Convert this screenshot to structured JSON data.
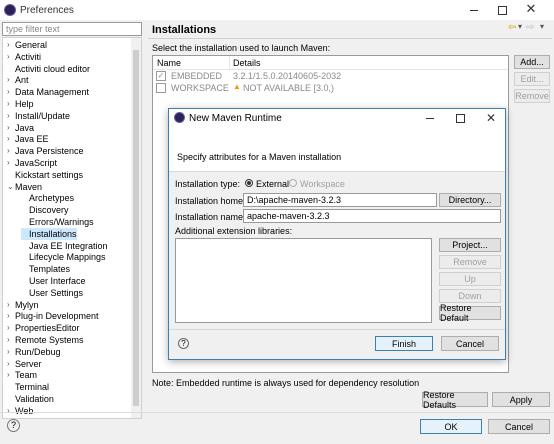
{
  "window": {
    "title": "Preferences"
  },
  "filter": {
    "placeholder": "type filter text"
  },
  "tree": [
    {
      "label": "General",
      "expanded": false,
      "level": 0
    },
    {
      "label": "Activiti",
      "expanded": false,
      "level": 0
    },
    {
      "label": "Activiti cloud editor",
      "expanded": null,
      "level": 0
    },
    {
      "label": "Ant",
      "expanded": false,
      "level": 0
    },
    {
      "label": "Data Management",
      "expanded": false,
      "level": 0
    },
    {
      "label": "Help",
      "expanded": false,
      "level": 0
    },
    {
      "label": "Install/Update",
      "expanded": false,
      "level": 0
    },
    {
      "label": "Java",
      "expanded": false,
      "level": 0
    },
    {
      "label": "Java EE",
      "expanded": false,
      "level": 0
    },
    {
      "label": "Java Persistence",
      "expanded": false,
      "level": 0
    },
    {
      "label": "JavaScript",
      "expanded": false,
      "level": 0
    },
    {
      "label": "Kickstart settings",
      "expanded": null,
      "level": 0
    },
    {
      "label": "Maven",
      "expanded": true,
      "level": 0
    },
    {
      "label": "Archetypes",
      "expanded": null,
      "level": 1
    },
    {
      "label": "Discovery",
      "expanded": null,
      "level": 1
    },
    {
      "label": "Errors/Warnings",
      "expanded": null,
      "level": 1
    },
    {
      "label": "Installations",
      "expanded": null,
      "level": 1,
      "selected": true
    },
    {
      "label": "Java EE Integration",
      "expanded": null,
      "level": 1
    },
    {
      "label": "Lifecycle Mappings",
      "expanded": null,
      "level": 1
    },
    {
      "label": "Templates",
      "expanded": null,
      "level": 1
    },
    {
      "label": "User Interface",
      "expanded": null,
      "level": 1
    },
    {
      "label": "User Settings",
      "expanded": null,
      "level": 1
    },
    {
      "label": "Mylyn",
      "expanded": false,
      "level": 0
    },
    {
      "label": "Plug-in Development",
      "expanded": false,
      "level": 0
    },
    {
      "label": "PropertiesEditor",
      "expanded": false,
      "level": 0
    },
    {
      "label": "Remote Systems",
      "expanded": false,
      "level": 0
    },
    {
      "label": "Run/Debug",
      "expanded": false,
      "level": 0
    },
    {
      "label": "Server",
      "expanded": false,
      "level": 0
    },
    {
      "label": "Team",
      "expanded": false,
      "level": 0
    },
    {
      "label": "Terminal",
      "expanded": null,
      "level": 0
    },
    {
      "label": "Validation",
      "expanded": null,
      "level": 0
    },
    {
      "label": "Web",
      "expanded": false,
      "level": 0
    }
  ],
  "page": {
    "title": "Installations",
    "instruction": "Select the installation used to launch Maven:",
    "columns": [
      "Name",
      "Details"
    ],
    "rows": [
      {
        "name": "EMBEDDED",
        "details": "3.2.1/1.5.0.20140605-2032",
        "checked": true
      },
      {
        "name": "WORKSPACE",
        "details": "NOT AVAILABLE [3.0,)",
        "checked": false,
        "warning": true
      }
    ],
    "buttons": {
      "add": "Add...",
      "edit": "Edit...",
      "remove": "Remove"
    },
    "note": "Note: Embedded runtime is always used for dependency resolution"
  },
  "footer": {
    "restore_defaults": "Restore Defaults",
    "apply": "Apply",
    "ok": "OK",
    "cancel": "Cancel"
  },
  "dialog": {
    "title": "New Maven Runtime",
    "description": "Specify attributes for a Maven installation",
    "install_type_label": "Installation type:",
    "opt_external": "External",
    "opt_workspace": "Workspace",
    "home_label": "Installation home:",
    "home_value": "D:\\apache-maven-3.2.3",
    "directory_btn": "Directory...",
    "name_label": "Installation name:",
    "name_value": "apache-maven-3.2.3",
    "ext_label": "Additional extension libraries:",
    "btn_project": "Project...",
    "btn_remove": "Remove",
    "btn_up": "Up",
    "btn_down": "Down",
    "btn_restore": "Restore Default",
    "btn_finish": "Finish",
    "btn_cancel": "Cancel",
    "help": "?"
  },
  "colors": {
    "accent": "#0078d7",
    "selection": "#cce8ff"
  }
}
